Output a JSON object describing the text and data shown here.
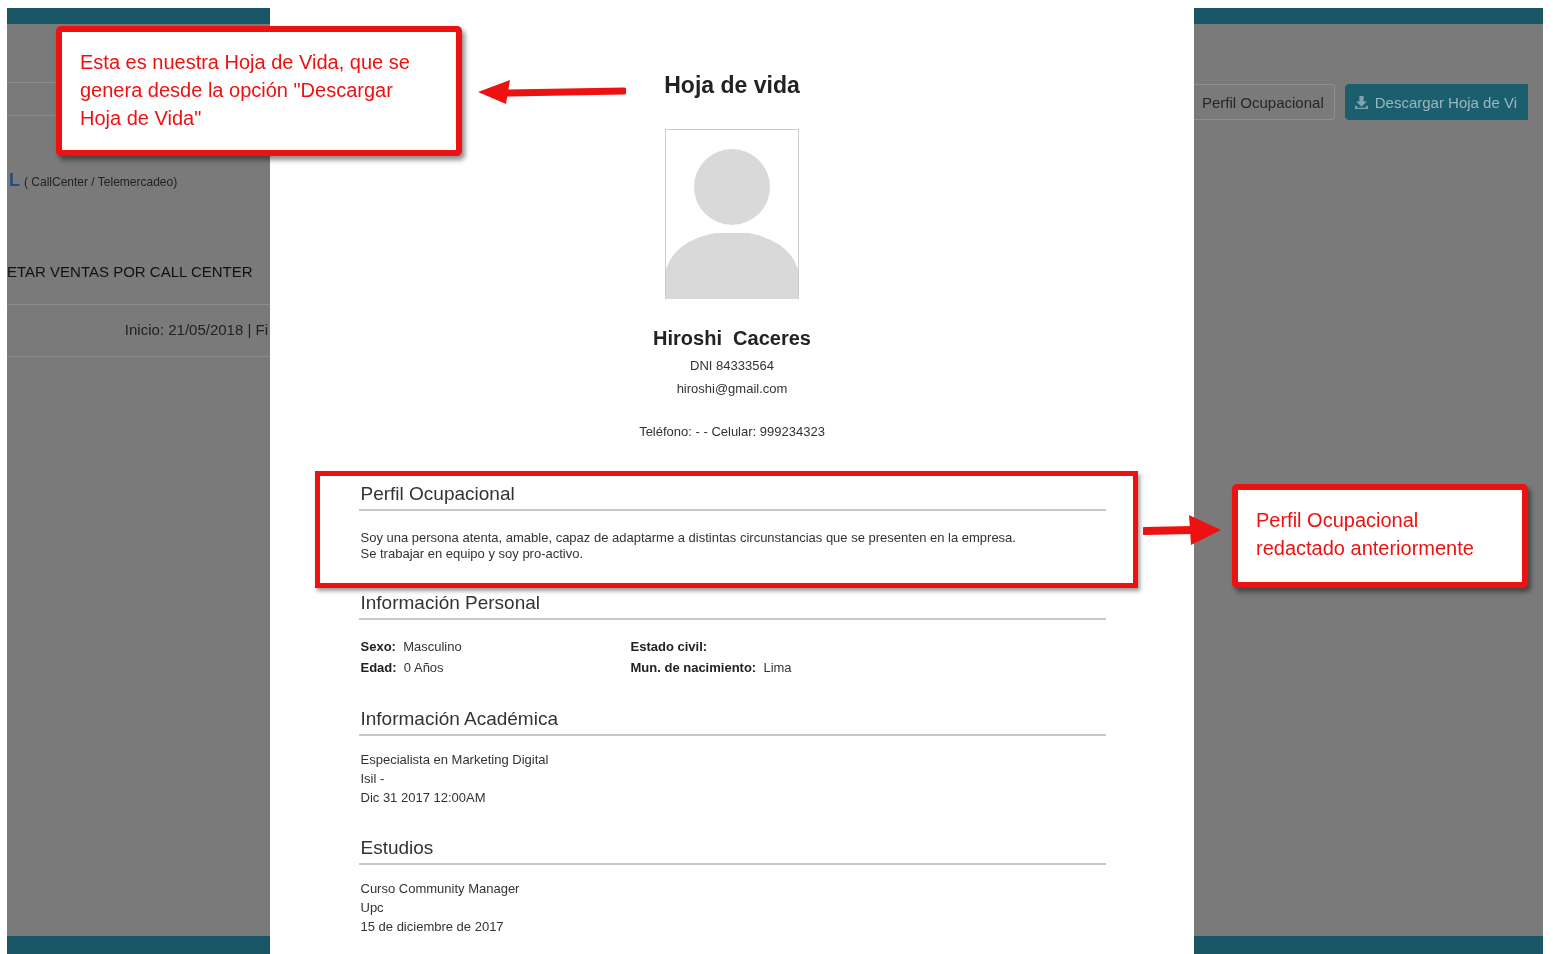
{
  "background": {
    "left": {
      "category_initial": "L",
      "category": "( CallCenter / Telemercadeo)",
      "title": "ETAR VENTAS POR CALL CENTER",
      "dates": "Inicio: 21/05/2018 | Fi"
    },
    "right": {
      "buttons": [
        {
          "label": "Perfil Ocupacional",
          "kind": "outline"
        },
        {
          "label": "Descargar Hoja de Vi",
          "kind": "primary"
        }
      ]
    }
  },
  "modal": {
    "title": "Hoja de vida",
    "name": "Hiroshi  Caceres",
    "dni": "DNI 84333564",
    "email": "hiroshi@gmail.com",
    "phone": "Teléfono: - - Celular: 999234323",
    "sections": [
      {
        "kind": "text",
        "heading": "Perfil Ocupacional",
        "highlighted": true,
        "lines": [
          "Soy una persona atenta, amable, capaz de adaptarme a distintas circunstancias que se presenten en la empresa.",
          "Se trabajar en equipo y soy pro-activo."
        ]
      },
      {
        "kind": "fields",
        "heading": "Información Personal",
        "highlighted": false,
        "columns": [
          [
            {
              "label": "Sexo:",
              "value": "Masculino"
            },
            {
              "label": "Edad:",
              "value": "0 Años"
            }
          ],
          [
            {
              "label": "Estado civil:"
            },
            {
              "label": "Mun. de nacimiento:",
              "value": "Lima"
            }
          ]
        ]
      },
      {
        "kind": "text",
        "heading": "Información Académica",
        "highlighted": false,
        "lines": [
          "Especialista en Marketing Digital",
          "Isil -",
          "Dic 31 2017 12:00AM"
        ]
      },
      {
        "kind": "text",
        "heading": "Estudios",
        "highlighted": false,
        "lines": [
          "Curso Community Manager",
          "Upc",
          "15 de diciembre de 2017"
        ]
      }
    ]
  },
  "annotations": [
    {
      "kind": "left",
      "text": "Esta es nuestra Hoja de Vida, que se genera desde la opción \"Descargar Hoja de Vida\""
    },
    {
      "kind": "right",
      "text": "Perfil Ocupacional redactado anteriormente"
    }
  ]
}
